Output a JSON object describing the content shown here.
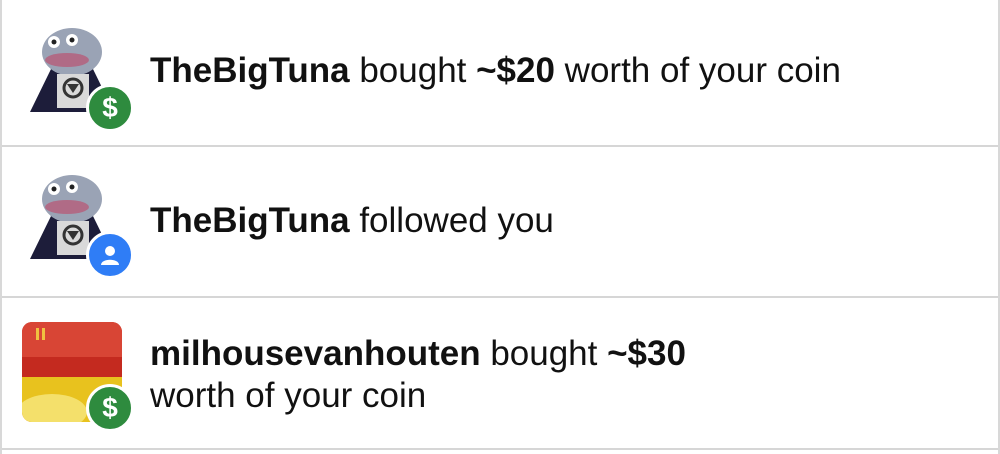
{
  "notifications": [
    {
      "username": "TheBigTuna",
      "action_prefix": " bought ",
      "amount": "~$20",
      "action_suffix": " worth of your coin",
      "badge_icon": "dollar-icon",
      "badge_glyph": "$",
      "badge_color": "#2e8b3e"
    },
    {
      "username": "TheBigTuna",
      "action_prefix": " followed you",
      "badge_icon": "person-icon",
      "badge_color": "#2f7df6"
    },
    {
      "username": "milhousevanhouten",
      "action_prefix": " bought ",
      "amount": "~$30",
      "action_line2": "worth of your coin",
      "badge_icon": "dollar-icon",
      "badge_glyph": "$",
      "badge_color": "#2e8b3e"
    }
  ]
}
